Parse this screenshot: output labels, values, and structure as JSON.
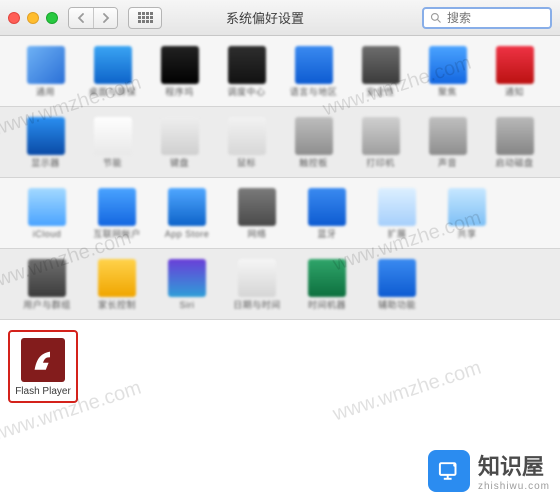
{
  "window": {
    "title": "系统偏好设置",
    "search_placeholder": "搜索"
  },
  "rows": [
    [
      {
        "id": "general",
        "label": "通用"
      },
      {
        "id": "desktop",
        "label": "桌面与屏保"
      },
      {
        "id": "dock",
        "label": "程序坞"
      },
      {
        "id": "mission",
        "label": "调度中心"
      },
      {
        "id": "language",
        "label": "语言与地区"
      },
      {
        "id": "security",
        "label": "安全性"
      },
      {
        "id": "spotlight",
        "label": "聚焦"
      },
      {
        "id": "notif",
        "label": "通知"
      }
    ],
    [
      {
        "id": "displays",
        "label": "显示器"
      },
      {
        "id": "energy",
        "label": "节能"
      },
      {
        "id": "keyboard",
        "label": "键盘"
      },
      {
        "id": "mouse",
        "label": "鼠标"
      },
      {
        "id": "trackpad",
        "label": "触控板"
      },
      {
        "id": "printer",
        "label": "打印机"
      },
      {
        "id": "sound",
        "label": "声音"
      },
      {
        "id": "startup",
        "label": "启动磁盘"
      }
    ],
    [
      {
        "id": "icloud",
        "label": "iCloud"
      },
      {
        "id": "internet",
        "label": "互联网帐户"
      },
      {
        "id": "appstore",
        "label": "App Store"
      },
      {
        "id": "network",
        "label": "网络"
      },
      {
        "id": "bluetooth",
        "label": "蓝牙"
      },
      {
        "id": "ext",
        "label": "扩展"
      },
      {
        "id": "sharing",
        "label": "共享"
      }
    ],
    [
      {
        "id": "users",
        "label": "用户与群组"
      },
      {
        "id": "parental",
        "label": "家长控制"
      },
      {
        "id": "siri",
        "label": "Siri"
      },
      {
        "id": "datetime",
        "label": "日期与时间"
      },
      {
        "id": "tm",
        "label": "时间机器"
      },
      {
        "id": "a11y",
        "label": "辅助功能"
      }
    ]
  ],
  "highlighted": {
    "id": "flash",
    "label": "Flash Player"
  },
  "brand": {
    "name": "知识屋",
    "domain": "zhishiwu.com"
  },
  "watermark": "www.wmzhe.com",
  "icon_colors": {
    "general": "linear-gradient(135deg,#6fb2f5,#2a6fd6)",
    "desktop": "linear-gradient(#3aa4f3,#0d63c9)",
    "dock": "linear-gradient(#222,#000)",
    "mission": "linear-gradient(#2e2e2e,#111)",
    "language": "linear-gradient(#3a8af0,#0d5bd1)",
    "security": "linear-gradient(#6d6d6d,#3a3a3a)",
    "spotlight": "linear-gradient(#4aa3ff,#1366e0)",
    "notif": "linear-gradient(#e34,#b11)",
    "displays": "linear-gradient(#2a8ff0,#0a4aa6)",
    "energy": "linear-gradient(#fefefe,#e8e8e8)",
    "keyboard": "linear-gradient(#eeeeee,#cfcfcf)",
    "mouse": "linear-gradient(#f2f2f2,#d7d7d7)",
    "trackpad": "linear-gradient(#bdbdbd,#8e8e8e)",
    "printer": "linear-gradient(#cfcfcf,#9e9e9e)",
    "sound": "linear-gradient(#bfbfbf,#8e8e8e)",
    "startup": "linear-gradient(#b8b8b8,#858585)",
    "icloud": "linear-gradient(#a3d9ff,#4aa3ff)",
    "internet": "linear-gradient(#4aa3ff,#1366e0)",
    "appstore": "linear-gradient(#50a7ff,#0d63c9)",
    "network": "linear-gradient(#7a7a7a,#4a4a4a)",
    "bluetooth": "linear-gradient(#3a8af0,#0d5bd1)",
    "ext": "linear-gradient(#dcefff,#a6cffb)",
    "sharing": "linear-gradient(#c7e7ff,#7dbff5)",
    "users": "linear-gradient(#6e6e6e,#3c3c3c)",
    "parental": "linear-gradient(#ffd24a,#f0a500)",
    "siri": "linear-gradient(#6a3ed8,#2e9ed8)",
    "datetime": "linear-gradient(#f5f5f5,#d5d5d5)",
    "tm": "linear-gradient(#2fa56a,#0d6f3e)",
    "a11y": "linear-gradient(#3a8af0,#0d5bd1)"
  }
}
